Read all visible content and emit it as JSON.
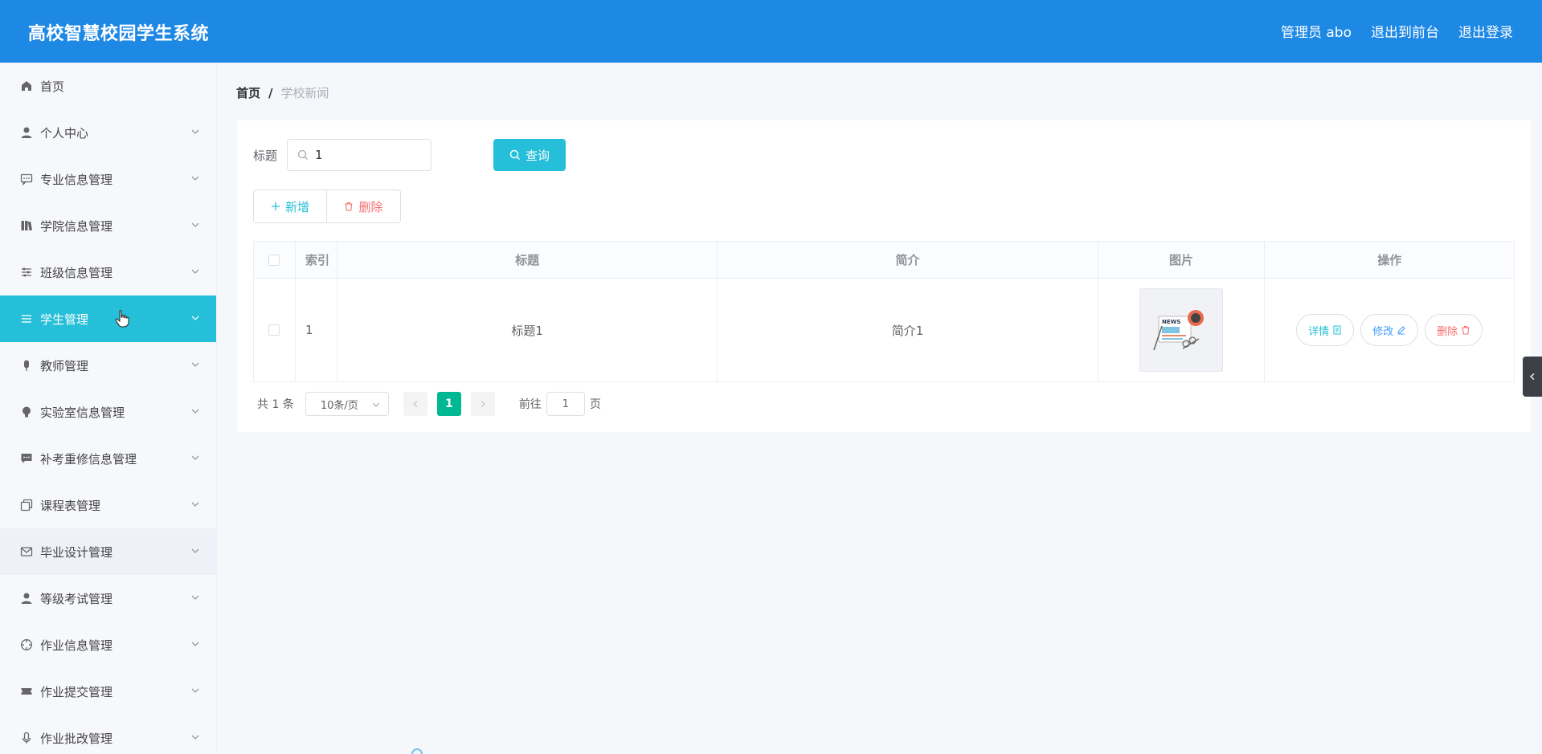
{
  "header": {
    "title": "高校智慧校园学生系统",
    "admin": "管理员 abo",
    "to_front": "退出到前台",
    "logout": "退出登录"
  },
  "sidebar": {
    "items": [
      {
        "label": "首页",
        "icon": "home-icon"
      },
      {
        "label": "个人中心",
        "icon": "user-icon"
      },
      {
        "label": "专业信息管理",
        "icon": "chat-icon"
      },
      {
        "label": "学院信息管理",
        "icon": "books-icon"
      },
      {
        "label": "班级信息管理",
        "icon": "sliders-icon"
      },
      {
        "label": "学生管理",
        "icon": "list-icon"
      },
      {
        "label": "教师管理",
        "icon": "mic-icon"
      },
      {
        "label": "实验室信息管理",
        "icon": "bulb-icon"
      },
      {
        "label": "补考重修信息管理",
        "icon": "message-icon"
      },
      {
        "label": "课程表管理",
        "icon": "copy-icon"
      },
      {
        "label": "毕业设计管理",
        "icon": "mail-icon"
      },
      {
        "label": "等级考试管理",
        "icon": "user-icon"
      },
      {
        "label": "作业信息管理",
        "icon": "target-icon"
      },
      {
        "label": "作业提交管理",
        "icon": "ticket-icon"
      },
      {
        "label": "作业批改管理",
        "icon": "microphone-icon"
      }
    ],
    "active_index": 5,
    "hover_index": 10
  },
  "breadcrumb": {
    "home": "首页",
    "separator": "/",
    "current": "学校新闻"
  },
  "search": {
    "label": "标题",
    "value": "1",
    "button": "查询"
  },
  "actions": {
    "add": "新增",
    "delete": "删除"
  },
  "table": {
    "headers": {
      "index": "索引",
      "title": "标题",
      "intro": "简介",
      "image": "图片",
      "ops": "操作"
    },
    "rows": [
      {
        "index": "1",
        "title": "标题1",
        "intro": "简介1",
        "image": "news-thumbnail",
        "ops": {
          "detail": "详情",
          "edit": "修改",
          "delete": "删除"
        }
      }
    ]
  },
  "pagination": {
    "total": "共 1 条",
    "page_size": "10条/页",
    "current": "1",
    "goto_label": "前往",
    "goto_value": "1",
    "page_suffix": "页"
  },
  "colors": {
    "header": "#1e88e5",
    "accent": "#26bfd9",
    "danger": "#f56c6c",
    "pager_active": "#00b894"
  }
}
